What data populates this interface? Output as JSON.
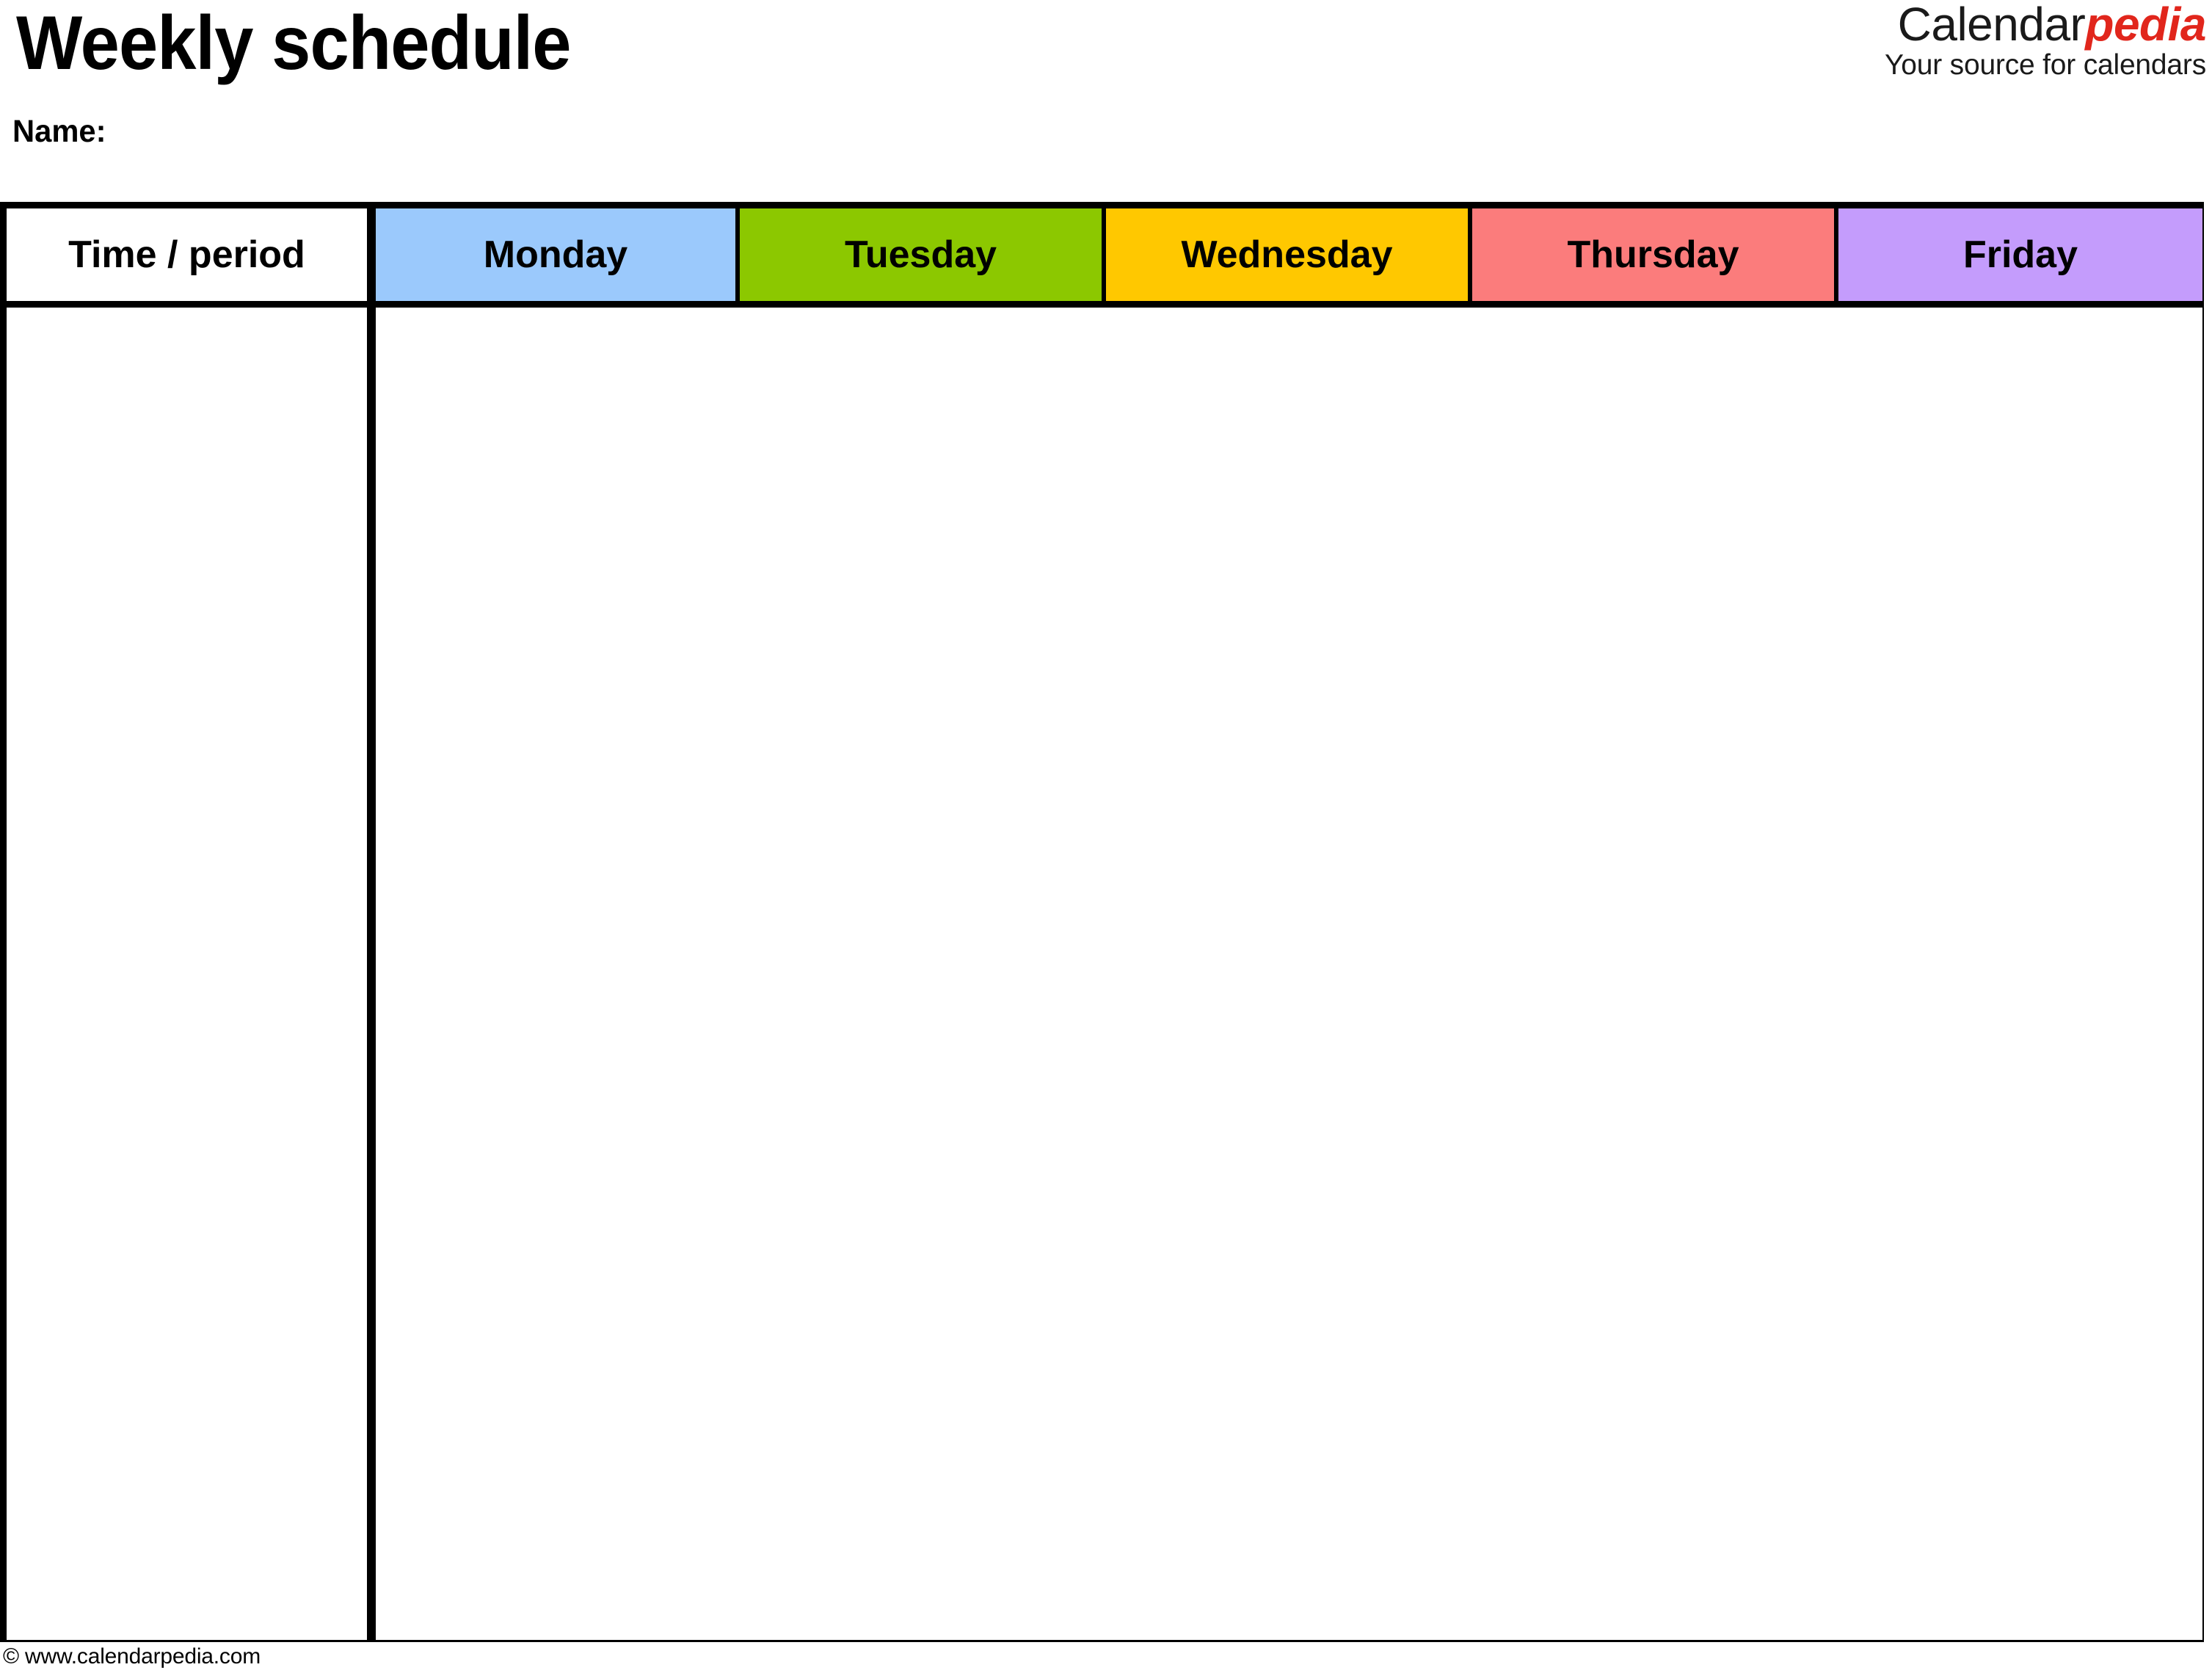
{
  "document": {
    "title": "Weekly schedule",
    "name_label": "Name:"
  },
  "brand": {
    "word_primary": "Calendar",
    "word_accent": "pedia",
    "tagline": "Your source for calendars",
    "accent_color": "#E1261C",
    "primary_color": "#1a1a1a"
  },
  "table": {
    "columns": [
      {
        "label": "Time / period",
        "key": "time",
        "bg": "#ffffff"
      },
      {
        "label": "Monday",
        "key": "monday",
        "bg": "#9BC9FC"
      },
      {
        "label": "Tuesday",
        "key": "tuesday",
        "bg": "#8CC800"
      },
      {
        "label": "Wednesday",
        "key": "wednesday",
        "bg": "#FFC800"
      },
      {
        "label": "Thursday",
        "key": "thursday",
        "bg": "#FB7C7C"
      },
      {
        "label": "Friday",
        "key": "friday",
        "bg": "#C49CFC"
      }
    ],
    "row_count": 13,
    "rows": [
      {
        "time": "",
        "monday": "",
        "tuesday": "",
        "wednesday": "",
        "thursday": "",
        "friday": ""
      },
      {
        "time": "",
        "monday": "",
        "tuesday": "",
        "wednesday": "",
        "thursday": "",
        "friday": ""
      },
      {
        "time": "",
        "monday": "",
        "tuesday": "",
        "wednesday": "",
        "thursday": "",
        "friday": ""
      },
      {
        "time": "",
        "monday": "",
        "tuesday": "",
        "wednesday": "",
        "thursday": "",
        "friday": ""
      },
      {
        "time": "",
        "monday": "",
        "tuesday": "",
        "wednesday": "",
        "thursday": "",
        "friday": ""
      },
      {
        "time": "",
        "monday": "",
        "tuesday": "",
        "wednesday": "",
        "thursday": "",
        "friday": ""
      },
      {
        "time": "",
        "monday": "",
        "tuesday": "",
        "wednesday": "",
        "thursday": "",
        "friday": ""
      },
      {
        "time": "",
        "monday": "",
        "tuesday": "",
        "wednesday": "",
        "thursday": "",
        "friday": ""
      },
      {
        "time": "",
        "monday": "",
        "tuesday": "",
        "wednesday": "",
        "thursday": "",
        "friday": ""
      },
      {
        "time": "",
        "monday": "",
        "tuesday": "",
        "wednesday": "",
        "thursday": "",
        "friday": ""
      },
      {
        "time": "",
        "monday": "",
        "tuesday": "",
        "wednesday": "",
        "thursday": "",
        "friday": ""
      },
      {
        "time": "",
        "monday": "",
        "tuesday": "",
        "wednesday": "",
        "thursday": "",
        "friday": ""
      },
      {
        "time": "",
        "monday": "",
        "tuesday": "",
        "wednesday": "",
        "thursday": "",
        "friday": ""
      }
    ]
  },
  "footer": {
    "copyright": "© www.calendarpedia.com"
  }
}
